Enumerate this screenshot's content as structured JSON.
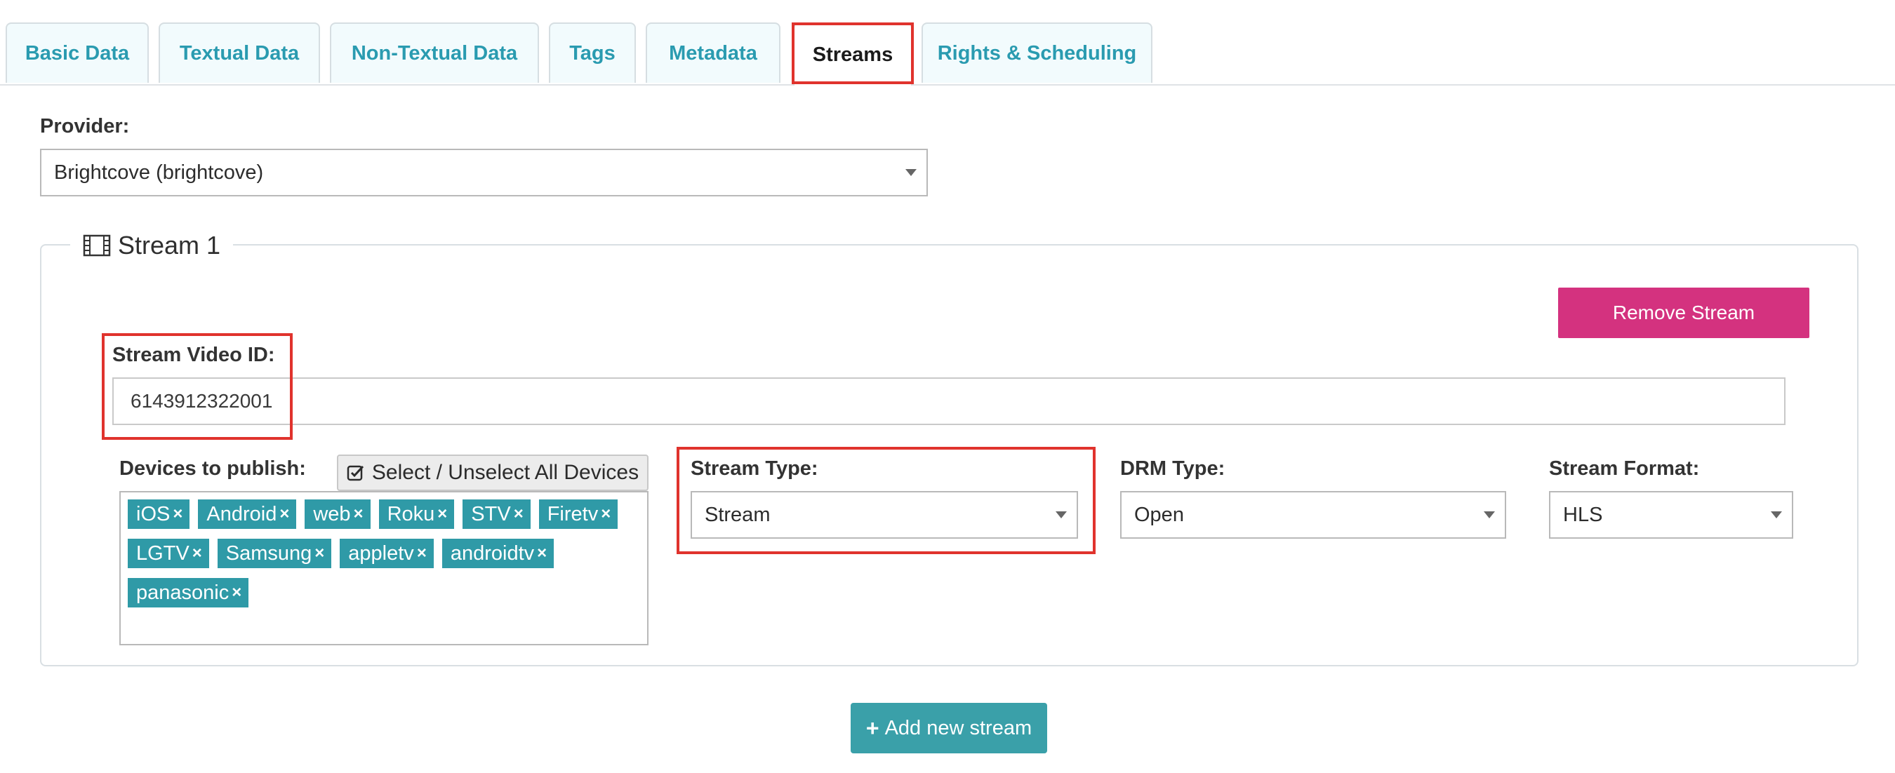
{
  "tabs": [
    {
      "label": "Basic Data"
    },
    {
      "label": "Textual Data"
    },
    {
      "label": "Non-Textual Data"
    },
    {
      "label": "Tags"
    },
    {
      "label": "Metadata"
    },
    {
      "label": "Streams"
    },
    {
      "label": "Rights & Scheduling"
    }
  ],
  "active_tab": "Streams",
  "provider": {
    "label": "Provider:",
    "value": "Brightcove (brightcove)"
  },
  "stream": {
    "legend": "Stream 1",
    "remove_label": "Remove Stream",
    "video_id_label": "Stream Video ID:",
    "video_id_value": "6143912322001",
    "devices_label": "Devices to publish:",
    "select_all_label": "Select / Unselect All Devices",
    "devices": [
      "iOS",
      "Android",
      "web",
      "Roku",
      "STV",
      "Firetv",
      "LGTV",
      "Samsung",
      "appletv",
      "androidtv",
      "panasonic"
    ],
    "stream_type_label": "Stream Type:",
    "stream_type_value": "Stream",
    "drm_type_label": "DRM Type:",
    "drm_type_value": "Open",
    "stream_format_label": "Stream Format:",
    "stream_format_value": "HLS"
  },
  "add_stream_label": "Add new stream",
  "colors": {
    "tab_text": "#2a9bb0",
    "highlight": "#e0332d",
    "remove_button": "#d4327f",
    "chip": "#2f9aa7",
    "add_button": "#3aa0a9"
  }
}
